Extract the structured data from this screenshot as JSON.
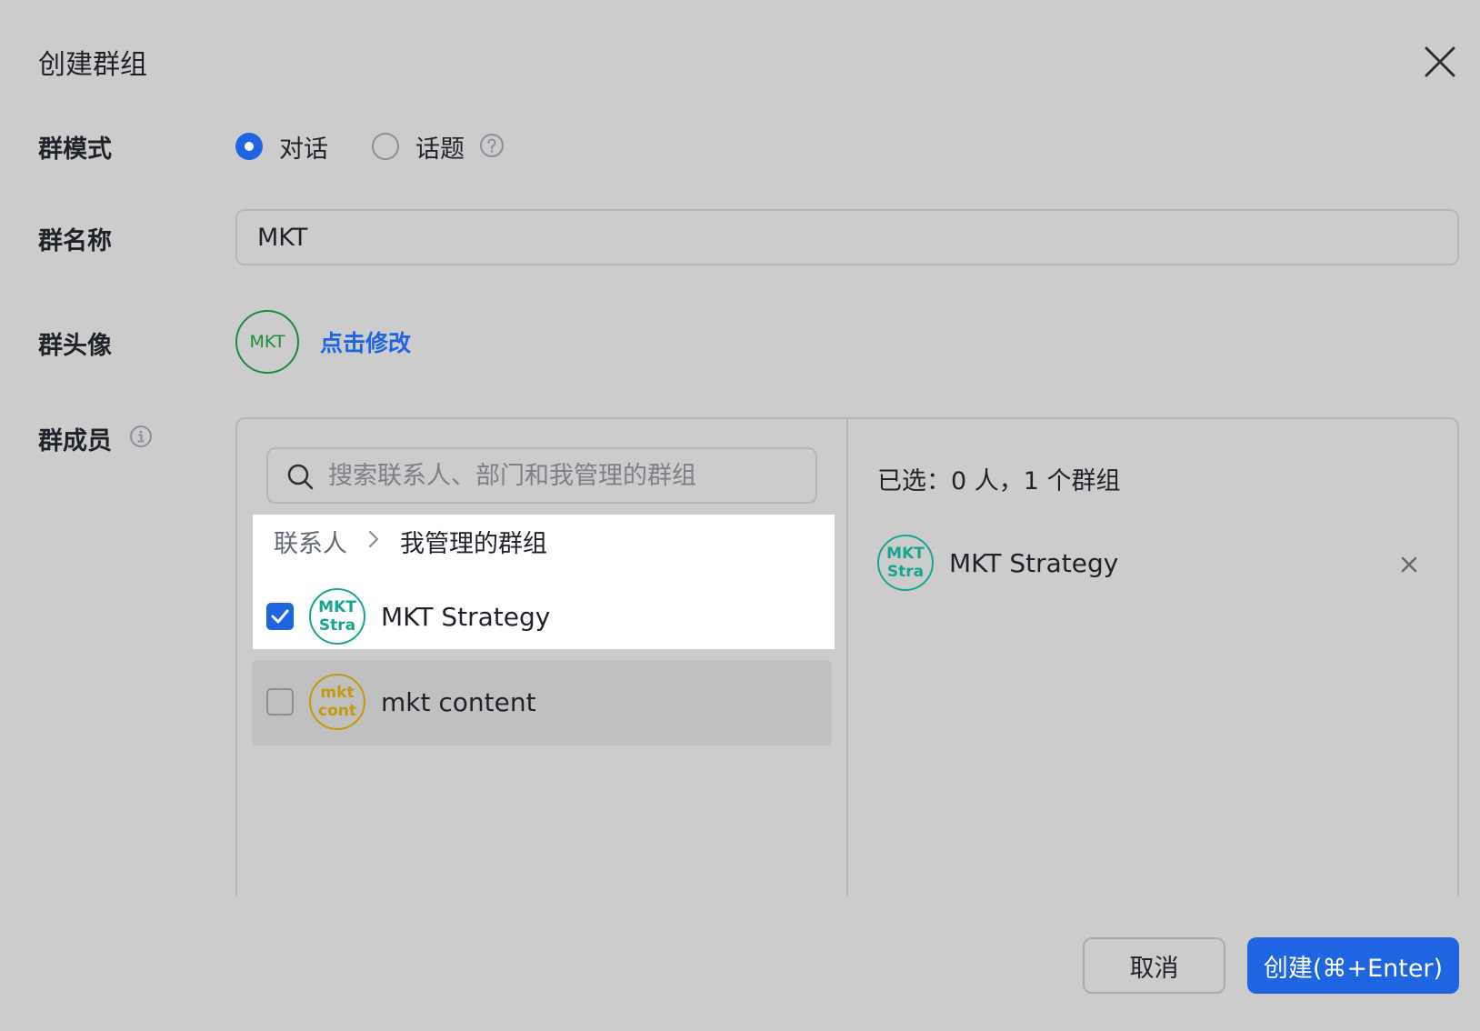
{
  "dialog": {
    "title": "创建群组"
  },
  "mode": {
    "label": "群模式",
    "options": [
      {
        "label": "对话",
        "selected": true
      },
      {
        "label": "话题",
        "selected": false
      }
    ]
  },
  "name": {
    "label": "群名称",
    "value": "MKT"
  },
  "avatar": {
    "label": "群头像",
    "text": "MKT",
    "color": "#1f8a3a",
    "edit_link": "点击修改"
  },
  "members": {
    "label": "群成员",
    "search_placeholder": "搜索联系人、部门和我管理的群组",
    "breadcrumb": {
      "root": "联系人",
      "current": "我管理的群组"
    },
    "list": [
      {
        "name": "MKT Strategy",
        "avatar_line1": "MKT",
        "avatar_line2": "Stra",
        "checked": true,
        "avatar_color": "#16a58e"
      },
      {
        "name": "mkt content",
        "avatar_line1": "mkt",
        "avatar_line2": "cont",
        "checked": false,
        "avatar_color": "#c49a0a"
      }
    ],
    "selected_summary": "已选：0 人，1 个群组",
    "selected": [
      {
        "name": "MKT Strategy",
        "avatar_line1": "MKT",
        "avatar_line2": "Stra",
        "avatar_color": "#16a58e"
      }
    ]
  },
  "footer": {
    "cancel": "取消",
    "create": "创建(⌘+Enter)"
  },
  "colors": {
    "accent": "#1f64e0",
    "background": "#cccccc"
  }
}
